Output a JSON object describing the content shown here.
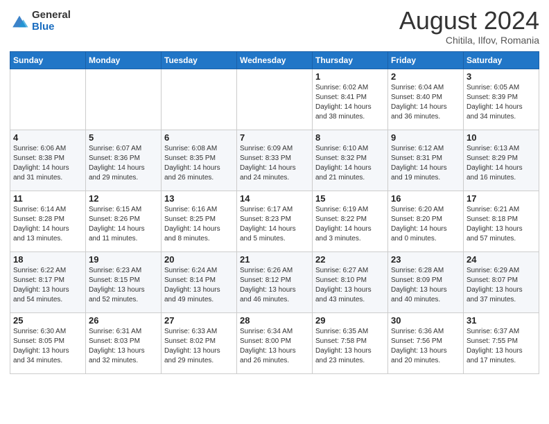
{
  "header": {
    "logo_general": "General",
    "logo_blue": "Blue",
    "month_title": "August 2024",
    "subtitle": "Chitila, Ilfov, Romania"
  },
  "weekdays": [
    "Sunday",
    "Monday",
    "Tuesday",
    "Wednesday",
    "Thursday",
    "Friday",
    "Saturday"
  ],
  "weeks": [
    [
      {
        "day": "",
        "info": ""
      },
      {
        "day": "",
        "info": ""
      },
      {
        "day": "",
        "info": ""
      },
      {
        "day": "",
        "info": ""
      },
      {
        "day": "1",
        "info": "Sunrise: 6:02 AM\nSunset: 8:41 PM\nDaylight: 14 hours\nand 38 minutes."
      },
      {
        "day": "2",
        "info": "Sunrise: 6:04 AM\nSunset: 8:40 PM\nDaylight: 14 hours\nand 36 minutes."
      },
      {
        "day": "3",
        "info": "Sunrise: 6:05 AM\nSunset: 8:39 PM\nDaylight: 14 hours\nand 34 minutes."
      }
    ],
    [
      {
        "day": "4",
        "info": "Sunrise: 6:06 AM\nSunset: 8:38 PM\nDaylight: 14 hours\nand 31 minutes."
      },
      {
        "day": "5",
        "info": "Sunrise: 6:07 AM\nSunset: 8:36 PM\nDaylight: 14 hours\nand 29 minutes."
      },
      {
        "day": "6",
        "info": "Sunrise: 6:08 AM\nSunset: 8:35 PM\nDaylight: 14 hours\nand 26 minutes."
      },
      {
        "day": "7",
        "info": "Sunrise: 6:09 AM\nSunset: 8:33 PM\nDaylight: 14 hours\nand 24 minutes."
      },
      {
        "day": "8",
        "info": "Sunrise: 6:10 AM\nSunset: 8:32 PM\nDaylight: 14 hours\nand 21 minutes."
      },
      {
        "day": "9",
        "info": "Sunrise: 6:12 AM\nSunset: 8:31 PM\nDaylight: 14 hours\nand 19 minutes."
      },
      {
        "day": "10",
        "info": "Sunrise: 6:13 AM\nSunset: 8:29 PM\nDaylight: 14 hours\nand 16 minutes."
      }
    ],
    [
      {
        "day": "11",
        "info": "Sunrise: 6:14 AM\nSunset: 8:28 PM\nDaylight: 14 hours\nand 13 minutes."
      },
      {
        "day": "12",
        "info": "Sunrise: 6:15 AM\nSunset: 8:26 PM\nDaylight: 14 hours\nand 11 minutes."
      },
      {
        "day": "13",
        "info": "Sunrise: 6:16 AM\nSunset: 8:25 PM\nDaylight: 14 hours\nand 8 minutes."
      },
      {
        "day": "14",
        "info": "Sunrise: 6:17 AM\nSunset: 8:23 PM\nDaylight: 14 hours\nand 5 minutes."
      },
      {
        "day": "15",
        "info": "Sunrise: 6:19 AM\nSunset: 8:22 PM\nDaylight: 14 hours\nand 3 minutes."
      },
      {
        "day": "16",
        "info": "Sunrise: 6:20 AM\nSunset: 8:20 PM\nDaylight: 14 hours\nand 0 minutes."
      },
      {
        "day": "17",
        "info": "Sunrise: 6:21 AM\nSunset: 8:18 PM\nDaylight: 13 hours\nand 57 minutes."
      }
    ],
    [
      {
        "day": "18",
        "info": "Sunrise: 6:22 AM\nSunset: 8:17 PM\nDaylight: 13 hours\nand 54 minutes."
      },
      {
        "day": "19",
        "info": "Sunrise: 6:23 AM\nSunset: 8:15 PM\nDaylight: 13 hours\nand 52 minutes."
      },
      {
        "day": "20",
        "info": "Sunrise: 6:24 AM\nSunset: 8:14 PM\nDaylight: 13 hours\nand 49 minutes."
      },
      {
        "day": "21",
        "info": "Sunrise: 6:26 AM\nSunset: 8:12 PM\nDaylight: 13 hours\nand 46 minutes."
      },
      {
        "day": "22",
        "info": "Sunrise: 6:27 AM\nSunset: 8:10 PM\nDaylight: 13 hours\nand 43 minutes."
      },
      {
        "day": "23",
        "info": "Sunrise: 6:28 AM\nSunset: 8:09 PM\nDaylight: 13 hours\nand 40 minutes."
      },
      {
        "day": "24",
        "info": "Sunrise: 6:29 AM\nSunset: 8:07 PM\nDaylight: 13 hours\nand 37 minutes."
      }
    ],
    [
      {
        "day": "25",
        "info": "Sunrise: 6:30 AM\nSunset: 8:05 PM\nDaylight: 13 hours\nand 34 minutes."
      },
      {
        "day": "26",
        "info": "Sunrise: 6:31 AM\nSunset: 8:03 PM\nDaylight: 13 hours\nand 32 minutes."
      },
      {
        "day": "27",
        "info": "Sunrise: 6:33 AM\nSunset: 8:02 PM\nDaylight: 13 hours\nand 29 minutes."
      },
      {
        "day": "28",
        "info": "Sunrise: 6:34 AM\nSunset: 8:00 PM\nDaylight: 13 hours\nand 26 minutes."
      },
      {
        "day": "29",
        "info": "Sunrise: 6:35 AM\nSunset: 7:58 PM\nDaylight: 13 hours\nand 23 minutes."
      },
      {
        "day": "30",
        "info": "Sunrise: 6:36 AM\nSunset: 7:56 PM\nDaylight: 13 hours\nand 20 minutes."
      },
      {
        "day": "31",
        "info": "Sunrise: 6:37 AM\nSunset: 7:55 PM\nDaylight: 13 hours\nand 17 minutes."
      }
    ]
  ]
}
